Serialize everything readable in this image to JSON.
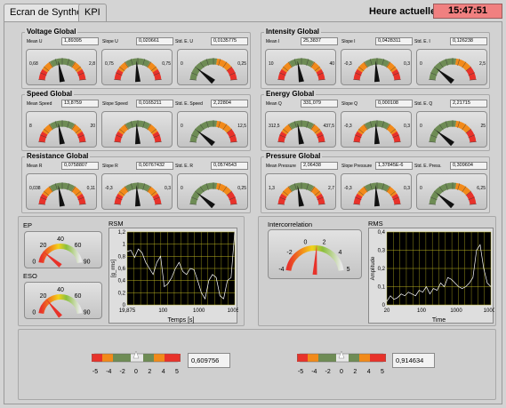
{
  "tabs": [
    {
      "label": "Ecran de Synthèse"
    },
    {
      "label": "KPI"
    }
  ],
  "clock": {
    "label": "Heure actuelle:",
    "value": "15:47:51"
  },
  "groups": [
    {
      "title": "Voltage Global",
      "stats": [
        {
          "label": "Mean U",
          "value": "1,89395"
        },
        {
          "label": "Slope U",
          "value": "0,020661"
        },
        {
          "label": "Std. E. U",
          "value": "0,0135775"
        }
      ],
      "gauges": [
        {
          "min": "0,68",
          "max": "2,8"
        },
        {
          "min": "0,75",
          "max": "0,75"
        },
        {
          "min": "0",
          "max": "0,25"
        }
      ]
    },
    {
      "title": "Intensity Global",
      "stats": [
        {
          "label": "Mean I",
          "value": "25,3837"
        },
        {
          "label": "Slope I",
          "value": "0,0428311"
        },
        {
          "label": "Std. E. I",
          "value": "0,126238"
        }
      ],
      "gauges": [
        {
          "min": "10",
          "max": "40"
        },
        {
          "min": "-0,3",
          "max": "0,3"
        },
        {
          "min": "0",
          "max": "2,5"
        }
      ]
    },
    {
      "title": "Speed Global",
      "stats": [
        {
          "label": "Mean Speed",
          "value": "13,8759"
        },
        {
          "label": "Slope Speed",
          "value": "0,0165211"
        },
        {
          "label": "Std. E. Speed",
          "value": "2,22804"
        }
      ],
      "gauges": [
        {
          "min": "8",
          "max": "20"
        },
        {
          "min": "",
          "max": ""
        },
        {
          "min": "0",
          "max": "12,5"
        }
      ]
    },
    {
      "title": "Energy Global",
      "stats": [
        {
          "label": "Mean Q",
          "value": "331,079"
        },
        {
          "label": "Slope Q",
          "value": "0,000108"
        },
        {
          "label": "Std. E. Q",
          "value": "2,21715"
        }
      ],
      "gauges": [
        {
          "min": "312,5",
          "max": "437,5"
        },
        {
          "min": "-0,3",
          "max": "0,3"
        },
        {
          "min": "0",
          "max": "25"
        }
      ]
    },
    {
      "title": "Resistance Global",
      "stats": [
        {
          "label": "Mean R",
          "value": "0,0758807"
        },
        {
          "label": "Slope R",
          "value": "0,00767432"
        },
        {
          "label": "Std. E. R",
          "value": "0,0574543"
        }
      ],
      "gauges": [
        {
          "min": "0,038",
          "max": "0,11"
        },
        {
          "min": "-0,3",
          "max": "0,3"
        },
        {
          "min": "0",
          "max": "0,25"
        }
      ]
    },
    {
      "title": "Pressure Global",
      "stats": [
        {
          "label": "Mean Pressure",
          "value": "2,06438"
        },
        {
          "label": "Slope Pressure",
          "value": "1,37845E-6"
        },
        {
          "label": "Std. E. Press.",
          "value": "0,309604"
        }
      ],
      "gauges": [
        {
          "min": "1,3",
          "max": "2,7"
        },
        {
          "min": "-0,3",
          "max": "0,3"
        },
        {
          "min": "0",
          "max": "6,25"
        }
      ]
    }
  ],
  "ep": {
    "label": "EP",
    "ticks": [
      "0",
      "20",
      "40",
      "60",
      "90"
    ]
  },
  "eso": {
    "label": "ESO",
    "ticks": [
      "0",
      "20",
      "40",
      "60",
      "90"
    ]
  },
  "rsm": {
    "label": "RSM",
    "ylabel": "[g_rms]",
    "xlabel": "Temps [s]",
    "yticks": [
      "1,2",
      "1",
      "0,8",
      "0,6",
      "0,4",
      "0,2",
      "0"
    ],
    "xticks": [
      "19,875",
      "100",
      "1000",
      "10050"
    ]
  },
  "intercorrelation": {
    "label": "Intercorrelation",
    "ticks": [
      "-4",
      "-2",
      "0",
      "2",
      "4",
      "5"
    ]
  },
  "rms": {
    "label": "RMS",
    "ylabel": "Amplitude",
    "xlabel": "Time",
    "yticks": [
      "0,4",
      "0,3",
      "0,2",
      "0,1",
      "0"
    ],
    "xticks": [
      "20",
      "100",
      "1000",
      "10000"
    ]
  },
  "bottom": {
    "left": {
      "ticks": [
        "-5",
        "-4",
        "-2",
        "0",
        "2",
        "4",
        "5"
      ],
      "value": "0,609756"
    },
    "right": {
      "ticks": [
        "-5",
        "-4",
        "-2",
        "0",
        "2",
        "4",
        "5"
      ],
      "value": "0,914634"
    }
  },
  "colors": {
    "red": "#e8322a",
    "orange": "#f28a1a",
    "yellow": "#f2d21a",
    "green": "#6e8c55",
    "clock": "#f08080",
    "grid": "#b8b020",
    "plotbg": "#000000"
  }
}
